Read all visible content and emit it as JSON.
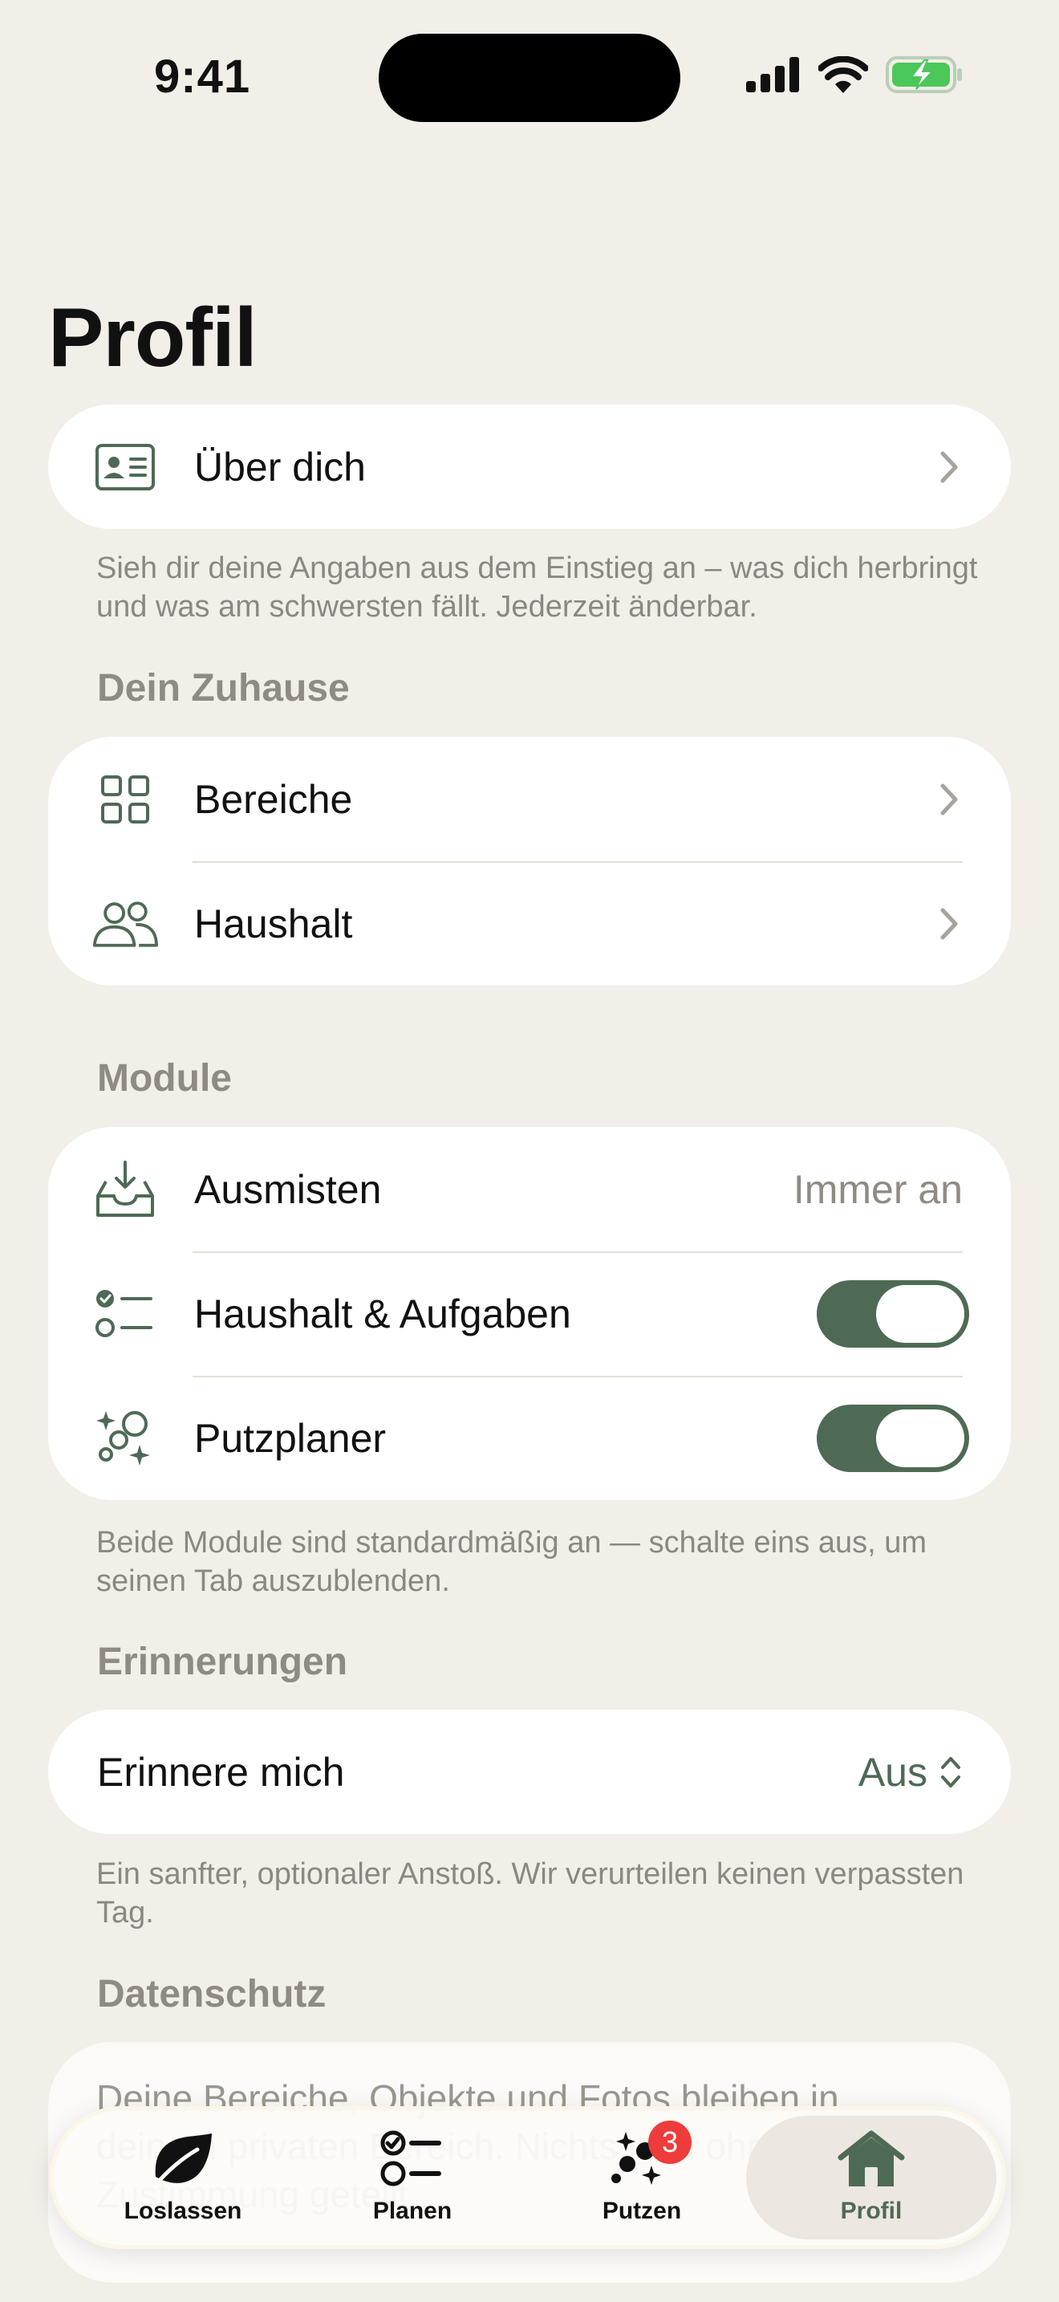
{
  "status_bar": {
    "time": "9:41"
  },
  "page": {
    "title": "Profil"
  },
  "about": {
    "label": "Über dich",
    "note": "Sieh dir deine Angaben aus dem Einstieg an – was dich herbringt und was am schwersten fällt. Jederzeit änderbar."
  },
  "home": {
    "header": "Dein Zuhause",
    "items": [
      {
        "label": "Bereiche",
        "icon": "grid-icon"
      },
      {
        "label": "Haushalt",
        "icon": "people-icon"
      }
    ]
  },
  "modules": {
    "header": "Module",
    "items": [
      {
        "label": "Ausmisten",
        "icon": "inbox-download-icon",
        "value": "Immer an"
      },
      {
        "label": "Haushalt & Aufgaben",
        "icon": "checklist-icon",
        "enabled": true
      },
      {
        "label": "Putzplaner",
        "icon": "bubbles-sparkle-icon",
        "enabled": true
      }
    ],
    "note": "Beide Module sind standardmäßig an — schalte eins aus, um seinen Tab auszublenden."
  },
  "reminders": {
    "header": "Erinnerungen",
    "label": "Erinnere mich",
    "value": "Aus",
    "note": "Ein sanfter, optionaler Anstoß. Wir verurteilen keinen verpassten Tag."
  },
  "privacy": {
    "header": "Datenschutz",
    "text": "Deine Bereiche, Objekte und Fotos bleiben in deinem privaten Bereich. Nichts wird ohne deine Zustimmung geteilt."
  },
  "tabbar": {
    "tabs": [
      {
        "label": "Loslassen",
        "icon": "leaf-icon",
        "active": false
      },
      {
        "label": "Planen",
        "icon": "checklist-icon",
        "active": false
      },
      {
        "label": "Putzen",
        "icon": "bubbles-sparkle-icon",
        "active": false,
        "badge": "3"
      },
      {
        "label": "Profil",
        "icon": "house-icon",
        "active": true
      }
    ]
  },
  "colors": {
    "background": "#F2EEE8",
    "accent": "#4E6A55",
    "secondary_text": "#8F8A84",
    "badge": "#EE3B3B"
  }
}
